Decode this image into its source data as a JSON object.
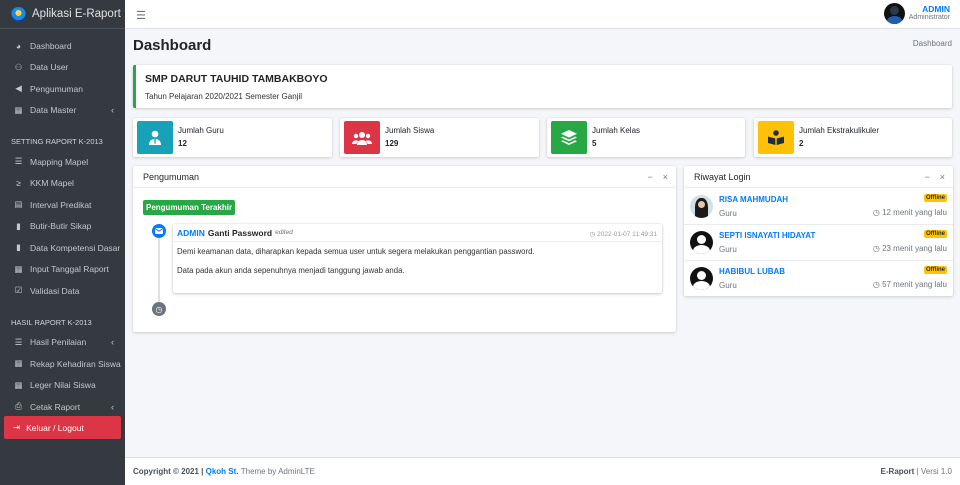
{
  "brand": {
    "title": "Aplikasi E-Raport"
  },
  "sidebar": {
    "items": [
      {
        "label": "Dashboard",
        "icon": "tachometer-icon",
        "glyph": "◕"
      },
      {
        "label": "Data User",
        "icon": "users-icon",
        "glyph": "👥"
      },
      {
        "label": "Pengumuman",
        "icon": "bullhorn-icon",
        "glyph": "📢"
      },
      {
        "label": "Data Master",
        "icon": "table-icon",
        "glyph": "▦",
        "chevron": "‹"
      }
    ],
    "header_setting": "SETTING RAPORT K-2013",
    "setting_items": [
      {
        "label": "Mapping Mapel",
        "icon": "list-icon",
        "glyph": "☰"
      },
      {
        "label": "KKM Mapel",
        "icon": "greater-equal-icon",
        "glyph": "≥"
      },
      {
        "label": "Interval Predikat",
        "icon": "interval-icon",
        "glyph": "▤"
      },
      {
        "label": "Butir-Butir Sikap",
        "icon": "file-icon",
        "glyph": "▮"
      },
      {
        "label": "Data Kompetensi Dasar",
        "icon": "clipboard-icon",
        "glyph": "▮"
      },
      {
        "label": "Input Tanggal Raport",
        "icon": "calendar-icon",
        "glyph": "▦"
      },
      {
        "label": "Validasi Data",
        "icon": "check-square-icon",
        "glyph": "☑"
      }
    ],
    "header_hasil": "HASIL RAPORT K-2013",
    "hasil_items": [
      {
        "label": "Hasil Penilaian",
        "icon": "list-ul-icon",
        "glyph": "☰",
        "chevron": "‹"
      },
      {
        "label": "Rekap Kehadiran Siswa",
        "icon": "calendar-check-icon",
        "glyph": "▦"
      },
      {
        "label": "Leger Nilai Siswa",
        "icon": "table-icon",
        "glyph": "▦"
      },
      {
        "label": "Cetak Raport",
        "icon": "print-icon",
        "glyph": "⎙",
        "chevron": "‹"
      }
    ],
    "logout": "Keluar / Logout"
  },
  "topbar": {
    "user_name": "ADMIN",
    "user_role": "Administrator"
  },
  "page": {
    "title": "Dashboard",
    "breadcrumb": "Dashboard"
  },
  "school": {
    "name": "SMP DARUT TAUHID TAMBAKBOYO",
    "period": "Tahun Pelajaran 2020/2021 Semester Ganjil"
  },
  "stats": [
    {
      "label": "Jumlah Guru",
      "value": "12",
      "color": "#17a2b8",
      "icon": "user-tie-icon"
    },
    {
      "label": "Jumlah Siswa",
      "value": "129",
      "color": "#dc3545",
      "icon": "users-icon"
    },
    {
      "label": "Jumlah Kelas",
      "value": "5",
      "color": "#28a745",
      "icon": "layers-icon"
    },
    {
      "label": "Jumlah Ekstrakulikuler",
      "value": "2",
      "color": "#ffc107",
      "icon": "book-reader-icon"
    }
  ],
  "announcement": {
    "title": "Pengumuman",
    "badge": "Pengumuman Terakhir",
    "author": "ADMIN",
    "action": "Ganti Password",
    "edited": "edited",
    "time": "2022-01-07 11:49:31",
    "body1": "Demi keamanan data, diharapkan kepada semua user untuk segera melakukan penggantian password.",
    "body2": "Data pada akun anda sepenuhnya menjadi tanggung jawab anda."
  },
  "logins": {
    "title": "Riwayat Login",
    "rows": [
      {
        "name": "RISA MAHMUDAH",
        "role": "Guru",
        "status": "Offline",
        "time": "12 menit yang lalu"
      },
      {
        "name": "SEPTI ISNAYATI HIDAYAT",
        "role": "Guru",
        "status": "Offline",
        "time": "23 menit yang lalu"
      },
      {
        "name": "HABIBUL LUBAB",
        "role": "Guru",
        "status": "Offline",
        "time": "57 menit yang lalu"
      }
    ]
  },
  "footer": {
    "copyright": "Copyright © 2021 |",
    "author": "Qkoh St.",
    "theme": "Theme by AdminLTE",
    "app": "E-Raport",
    "version": "| Versi 1.0"
  }
}
